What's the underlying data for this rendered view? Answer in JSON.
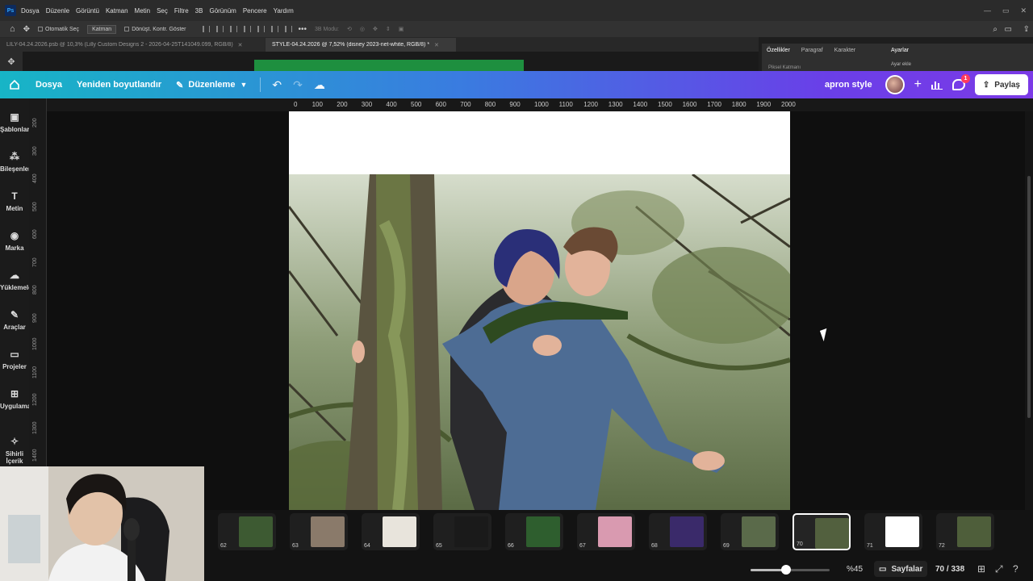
{
  "photoshop": {
    "menu": [
      "Dosya",
      "Düzenle",
      "Görüntü",
      "Katman",
      "Metin",
      "Seç",
      "Filtre",
      "3B",
      "Görünüm",
      "Pencere",
      "Yardım"
    ],
    "options": {
      "auto_select": "Otomatik Seç",
      "layer_select": "Katman",
      "transform_controls": "Dönüşt. Kontr. Göster",
      "mode": "3B Modu:"
    },
    "tabs": [
      {
        "label": "LILY-04.24.2026.psb @ 10,3% (Lilly Custom Designs 2 - 2026-04-25T141049.099, RGB/8)"
      },
      {
        "label": "STYLE-04.24.2026 @ 7,52% (disney 2023-net-white, RGB/8) *"
      }
    ],
    "panel": {
      "tabs": [
        "Özellikler",
        "Paragraf",
        "Karakter"
      ],
      "right_title": "Ayarlar",
      "right_sub": "Ayar ekle",
      "layer_label": "Piksel Katmanı"
    }
  },
  "canva": {
    "header": {
      "file": "Dosya",
      "resize": "Yeniden boyutlandır",
      "edit": "Düzenleme",
      "design_title": "apron style",
      "notification_count": "1",
      "share": "Paylaş"
    },
    "sidebar": [
      {
        "label": "Şablonlar",
        "icon": "templates-icon"
      },
      {
        "label": "Bileşenler",
        "icon": "elements-icon"
      },
      {
        "label": "Metin",
        "icon": "text-icon"
      },
      {
        "label": "Marka",
        "icon": "brand-icon"
      },
      {
        "label": "Yüklemeler",
        "icon": "uploads-icon"
      },
      {
        "label": "Araçlar",
        "icon": "draw-icon"
      },
      {
        "label": "Projeler",
        "icon": "projects-icon"
      },
      {
        "label": "Uygulamalar",
        "icon": "apps-icon"
      },
      {
        "label": "Sihirli İçerik",
        "icon": "magic-media-icon"
      }
    ],
    "ruler_h": [
      "0",
      "100",
      "200",
      "300",
      "400",
      "500",
      "600",
      "700",
      "800",
      "900",
      "1000",
      "1100",
      "1200",
      "1300",
      "1400",
      "1500",
      "1600",
      "1700",
      "1800",
      "1900",
      "2000"
    ],
    "ruler_v": [
      "200",
      "300",
      "400",
      "500",
      "600",
      "700",
      "800",
      "900",
      "1000",
      "1100",
      "1200",
      "1300",
      "1400"
    ],
    "thumbnails": [
      {
        "num": "62",
        "color": "#3d5a32"
      },
      {
        "num": "63",
        "color": "#8a7a6a"
      },
      {
        "num": "64",
        "color": "#e8e4dc"
      },
      {
        "num": "65",
        "color": "#1a1a1a"
      },
      {
        "num": "66",
        "color": "#2e5e2e"
      },
      {
        "num": "67",
        "color": "#d99ab0"
      },
      {
        "num": "68",
        "color": "#3a2a6a"
      },
      {
        "num": "69",
        "color": "#5a6a4a"
      },
      {
        "num": "70",
        "color": "#52603e"
      },
      {
        "num": "71",
        "color": "#ffffff"
      },
      {
        "num": "72",
        "color": "#4e5e3a"
      }
    ],
    "zoom": {
      "label": "%45",
      "level": 0.45
    },
    "pages_label": "Sayfalar",
    "page_count": "70 / 338"
  }
}
